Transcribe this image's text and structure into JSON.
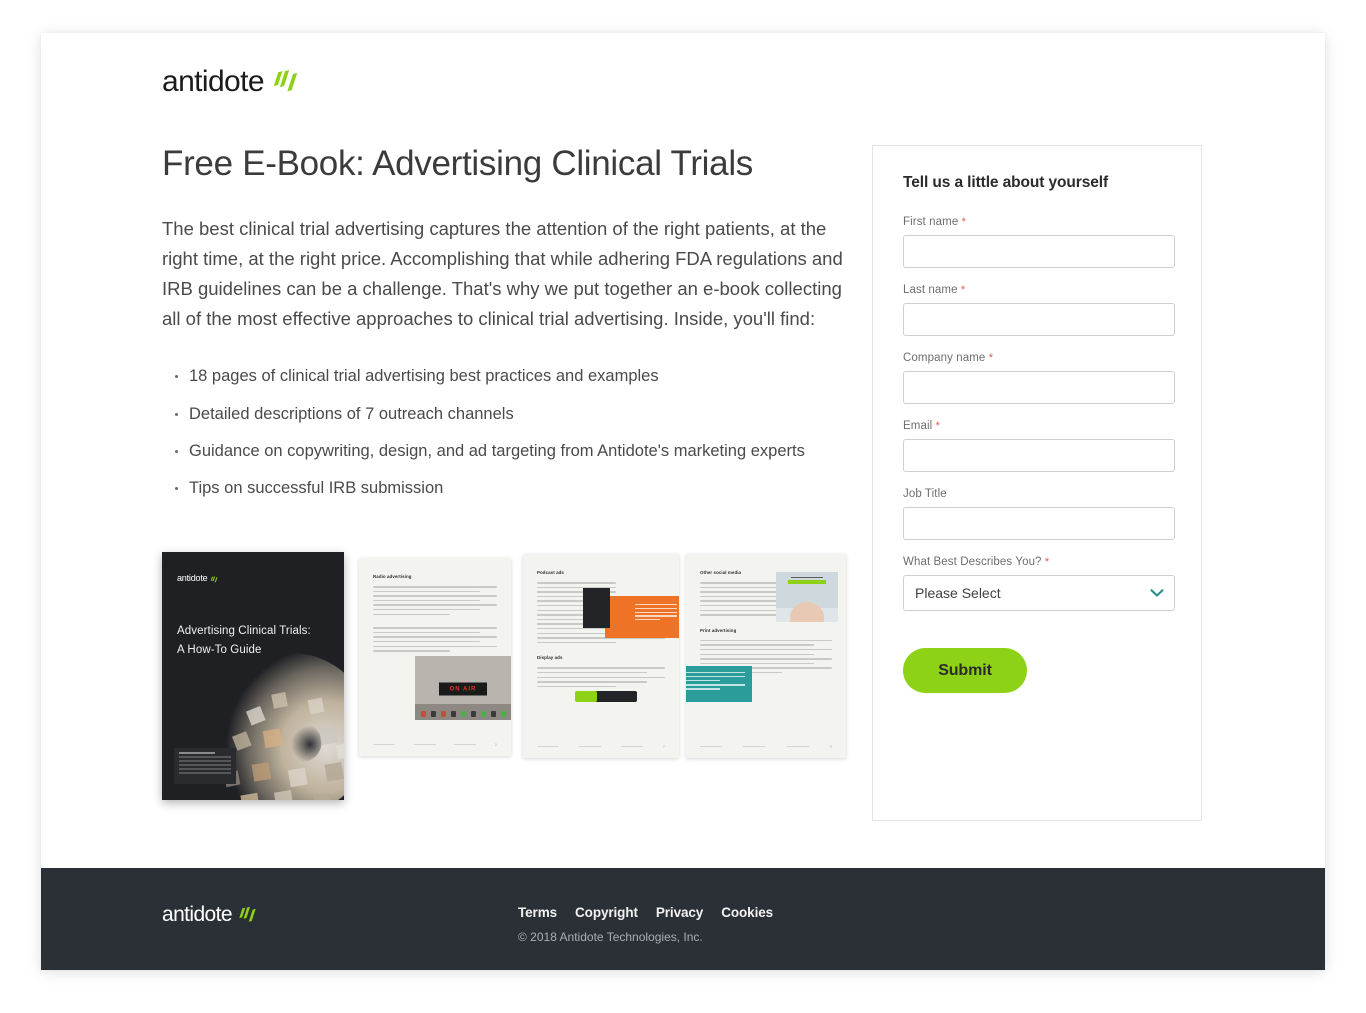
{
  "brand": {
    "name": "antidote",
    "mark_color": "#8DD216",
    "accent_color": "#8DD216"
  },
  "hero": {
    "headline": "Free E-Book: Advertising Clinical Trials",
    "paragraph": "The best clinical trial advertising captures the attention of the right patients, at the right time, at the right price. Accomplishing that while adhering FDA regulations and IRB guidelines can be a challenge. That's why we put together an e-book collecting all of the most effective approaches to clinical trial advertising. Inside, you'll find:",
    "bullets": [
      "18 pages of clinical trial advertising best practices and examples",
      "Detailed descriptions of 7 outreach channels",
      "Guidance on copywriting, design, and ad targeting from Antidote's marketing experts",
      "Tips on successful IRB submission"
    ]
  },
  "ebook_preview": {
    "cover": {
      "brand": "antidote",
      "title_line1": "Advertising Clinical Trials:",
      "title_line2": "A How-To Guide"
    },
    "pages": [
      {
        "heading": "Radio advertising",
        "image_label": "ON AIR"
      },
      {
        "heading": "Podcast ads",
        "heading2": "Display ads"
      },
      {
        "heading": "Other social media",
        "heading2": "Print advertising"
      }
    ]
  },
  "form": {
    "title": "Tell us a little about yourself",
    "fields": [
      {
        "label": "First name",
        "required": true,
        "value": "",
        "placeholder": ""
      },
      {
        "label": "Last name",
        "required": true,
        "value": "",
        "placeholder": ""
      },
      {
        "label": "Company name",
        "required": true,
        "value": "",
        "placeholder": ""
      },
      {
        "label": "Email",
        "required": true,
        "value": "",
        "placeholder": ""
      },
      {
        "label": "Job Title",
        "required": false,
        "value": "",
        "placeholder": ""
      }
    ],
    "select": {
      "label": "What Best Describes You?",
      "required": true,
      "selected": "Please Select",
      "chevron_icon": "chevron-down-icon",
      "chevron_color": "#2a8f8c"
    },
    "submit_label": "Submit",
    "required_marker": "*"
  },
  "footer": {
    "brand": "antidote",
    "links": [
      "Terms",
      "Copyright",
      "Privacy",
      "Cookies"
    ],
    "copyright": "© 2018 Antidote Technologies, Inc.",
    "background": "#2b3036"
  }
}
